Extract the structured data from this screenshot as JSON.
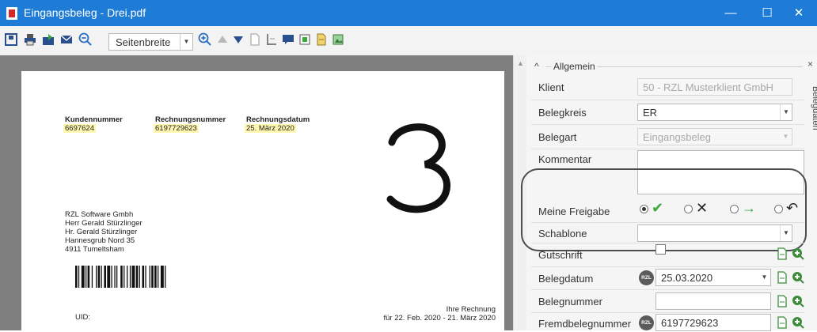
{
  "window": {
    "title": "Eingangsbeleg - Drei.pdf",
    "minimize": "—",
    "maximize": "☐",
    "close": "✕"
  },
  "toolbar": {
    "zoom_value": "Seitenbreite",
    "icons": [
      "save-icon",
      "print-icon",
      "export-icon",
      "mail-icon",
      "zoom-out-icon",
      "zoom-in-icon",
      "page-up-icon",
      "page-down-icon",
      "page-icon",
      "text-select-icon",
      "comment-icon",
      "fit-page-icon",
      "document-icon",
      "image-icon"
    ]
  },
  "document": {
    "kundennummer_label": "Kundennummer",
    "kundennummer": "6697624",
    "rechnungsnummer_label": "Rechnungsnummer",
    "rechnungsnummer": "6197729623",
    "rechnungsdatum_label": "Rechnungsdatum",
    "rechnungsdatum": "25. März 2020",
    "address": [
      "RZL Software Gmbh",
      "Herr Gerald Stürzlinger",
      "Hr. Gerald Stürzlinger",
      "Hannesgrub Nord 35",
      "4911 Tumeltsham"
    ],
    "uid_label": "UID:",
    "invoice_title": "Ihre Rechnung",
    "invoice_period": "für 22. Feb. 2020 - 21. März 2020"
  },
  "panel": {
    "tab_label": "Belegdaten",
    "tab_close": "×",
    "section": "Allgemein",
    "klient_label": "Klient",
    "klient_value": "50 - RZL Musterklient GmbH",
    "belegkreis_label": "Belegkreis",
    "belegkreis_value": "ER",
    "belegart_label": "Belegart",
    "belegart_value": "Eingangsbeleg",
    "kommentar_label": "Kommentar",
    "kommentar_value": "",
    "freigabe_label": "Meine Freigabe",
    "freigabe_options": [
      {
        "symbol": "✔",
        "color": "#3aa83a",
        "selected": true
      },
      {
        "symbol": "✕",
        "color": "#222222",
        "selected": false
      },
      {
        "symbol": "→",
        "color": "#3aa83a",
        "selected": false
      },
      {
        "symbol": "↶",
        "color": "#222222",
        "selected": false
      }
    ],
    "schablone_label": "Schablone",
    "schablone_value": "",
    "gutschrift_label": "Gutschrift",
    "gutschrift_checked": false,
    "belegdatum_label": "Belegdatum",
    "belegdatum_value": "25.03.2020",
    "belegnummer_label": "Belegnummer",
    "belegnummer_value": "",
    "fremdbelegnummer_label": "Fremdbelegnummer",
    "fremdbelegnummer_value": "6197729623",
    "rzl_badge": "RZL"
  },
  "colors": {
    "titlebar": "#1f7cd6",
    "highlight": "#fff7b0",
    "accept_green": "#3aa83a"
  }
}
